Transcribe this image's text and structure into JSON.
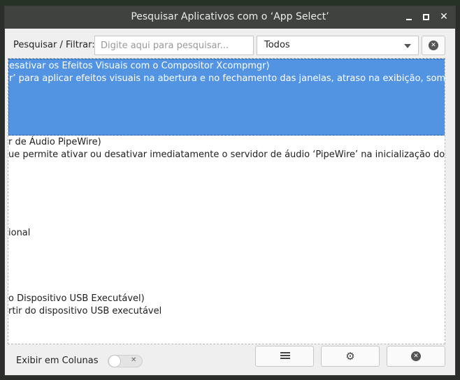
{
  "window": {
    "title": "Pesquisar Aplicativos com o ‘App Select’"
  },
  "search": {
    "label": "Pesquisar / Filtrar:",
    "placeholder": "Digite aqui para pesquisar...",
    "filter_value": "Todos"
  },
  "list": {
    "items": [
      {
        "line1": "esativar os Efeitos Visuais com o Compositor Xcompmgr)",
        "line2": "r’ para aplicar efeitos visuais na abertura e no fechamento das janelas, atraso na exibição, sombras, tr",
        "selected": true
      },
      {
        "line1": "r de Áudio PipeWire)",
        "line2": "ue permite ativar ou desativar imediatamente o servidor de áudio ‘PipeWire’ na inicialização do ant"
      },
      {
        "line1": "ional"
      },
      {
        "line1": "o Dispositivo USB Executável)",
        "line2": "rtir do dispositivo USB executável"
      }
    ]
  },
  "bottom": {
    "columns_label": "Exibir em Colunas",
    "columns_toggle_on": false
  },
  "icons": {
    "minimize": "minimize-icon",
    "maximize": "maximize-icon",
    "close": "close-icon",
    "clear": "circle-x-icon",
    "list": "list-lines-icon",
    "settings": "gear-icon",
    "dropdown": "chevron-down-icon"
  },
  "colors": {
    "titlebar": "#3f423f",
    "selection": "#5294e2",
    "window_bg": "#efefef"
  }
}
